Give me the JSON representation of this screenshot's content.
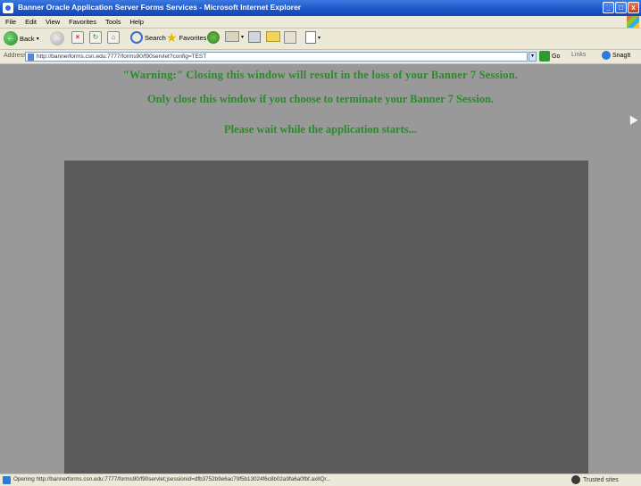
{
  "window": {
    "title": "Banner Oracle Application Server Forms Services - Microsoft Internet Explorer",
    "buttons": [
      "_",
      "□",
      "x"
    ]
  },
  "menu": {
    "items": [
      "File",
      "Edit",
      "View",
      "Favorites",
      "Tools",
      "Help"
    ]
  },
  "toolbar": {
    "back_label": "Back",
    "search_label": "Search",
    "favorites_label": "Favorites"
  },
  "address": {
    "label": "Address",
    "url": "http://bannerforms.csn.edu:7777/forms90/f90servlet?config=TEST",
    "go_label": "Go",
    "links_label": "Links",
    "snagit_label": "SnagIt"
  },
  "content": {
    "warning_line": "\"Warning:\" Closing this window will result in the loss of your Banner 7 Session.",
    "close_line": "Only close this window if you choose to terminate your Banner 7 Session.",
    "wait_line": "Please wait while the application starts..."
  },
  "status": {
    "text": "Opening http://bannerforms.csn.edu:7777/forms90/f90servlet;jsessionid=dfb3752b9e6ac79f5b13024f6c8b02a9fa6a0fbf.ax8Qr...",
    "zone": "Trusted sites"
  },
  "colors": {
    "message_green": "#2c8a2c",
    "page_background": "#999999",
    "applet_background": "#5a5a5a"
  }
}
